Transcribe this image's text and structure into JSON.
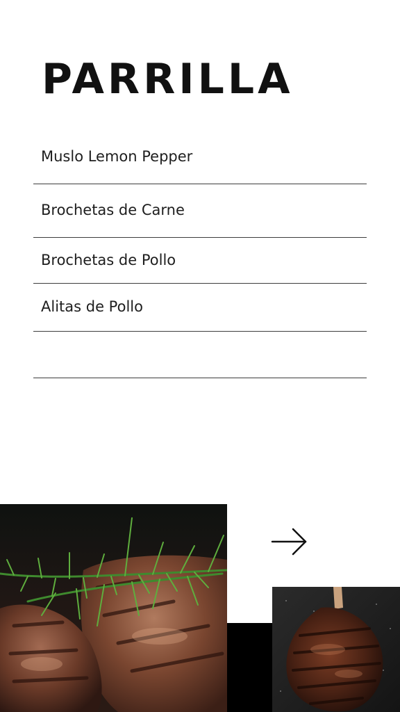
{
  "menu": {
    "title": "PARRILLA",
    "items": [
      {
        "label": "Muslo Lemon Pepper"
      },
      {
        "label": "Brochetas de Carne"
      },
      {
        "label": "Brochetas de Pollo"
      },
      {
        "label": "Alitas de Pollo"
      }
    ]
  },
  "icons": {
    "next": "arrow-right-icon"
  },
  "colors": {
    "text": "#111111",
    "divider": "#3c3c3c",
    "background": "#ffffff"
  }
}
